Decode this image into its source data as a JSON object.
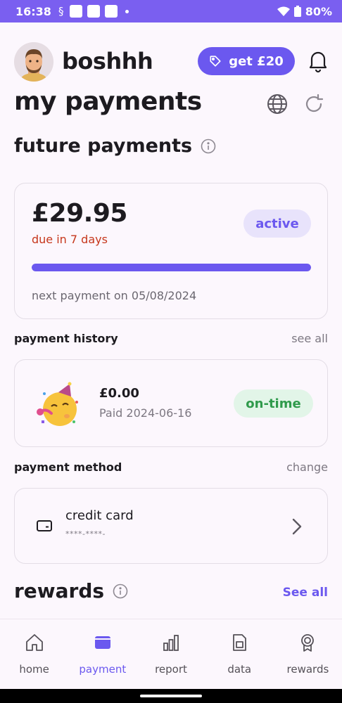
{
  "status": {
    "time": "16:38",
    "battery": "80%"
  },
  "header": {
    "username": "boshhh",
    "promo_label": "get £20"
  },
  "page": {
    "title": "my payments"
  },
  "future": {
    "heading": "future payments",
    "amount": "£29.95",
    "due": "due in 7 days",
    "badge": "active",
    "progress": 1.0,
    "next_payment": "next payment on 05/08/2024"
  },
  "history": {
    "heading": "payment history",
    "link": "see all",
    "item": {
      "amount": "£0.00",
      "date": "Paid 2024-06-16",
      "badge": "on-time"
    }
  },
  "method": {
    "heading": "payment method",
    "link": "change",
    "title": "credit card",
    "masked": "****-****-"
  },
  "rewards": {
    "heading": "rewards",
    "link": "See all"
  },
  "nav": [
    {
      "label": "home",
      "icon": "home-icon"
    },
    {
      "label": "payment",
      "icon": "wallet-icon"
    },
    {
      "label": "report",
      "icon": "bar-chart-icon"
    },
    {
      "label": "data",
      "icon": "sim-card-icon"
    },
    {
      "label": "rewards",
      "icon": "medal-icon"
    }
  ],
  "colors": {
    "accent": "#6b58ef",
    "status_bar": "#7a5ff0",
    "due": "#c6371c",
    "ontime": "#2f9a4b"
  }
}
